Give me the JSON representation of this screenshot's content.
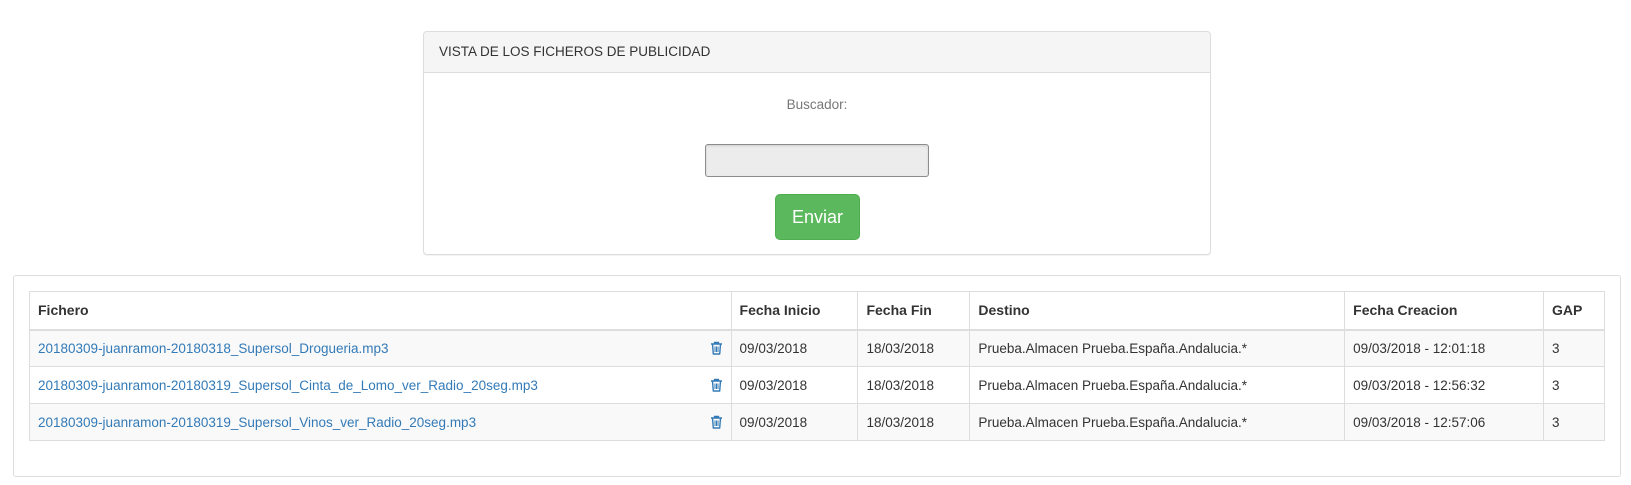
{
  "search": {
    "panel_title": "VISTA DE LOS FICHEROS DE PUBLICIDAD",
    "label": "Buscador:",
    "input_value": "",
    "submit_label": "Enviar"
  },
  "table": {
    "headers": {
      "file": "Fichero",
      "start_date": "Fecha Inicio",
      "end_date": "Fecha Fin",
      "destination": "Destino",
      "created": "Fecha Creacion",
      "gap": "GAP"
    },
    "rows": [
      {
        "file": "20180309-juanramon-20180318_Supersol_Drogueria.mp3",
        "start_date": "09/03/2018",
        "end_date": "18/03/2018",
        "destination": "Prueba.Almacen Prueba.España.Andalucia.*",
        "created": "09/03/2018 - 12:01:18",
        "gap": "3"
      },
      {
        "file": "20180309-juanramon-20180319_Supersol_Cinta_de_Lomo_ver_Radio_20seg.mp3",
        "start_date": "09/03/2018",
        "end_date": "18/03/2018",
        "destination": "Prueba.Almacen Prueba.España.Andalucia.*",
        "created": "09/03/2018 - 12:56:32",
        "gap": "3"
      },
      {
        "file": "20180309-juanramon-20180319_Supersol_Vinos_ver_Radio_20seg.mp3",
        "start_date": "09/03/2018",
        "end_date": "18/03/2018",
        "destination": "Prueba.Almacen Prueba.España.Andalucia.*",
        "created": "09/03/2018 - 12:57:06",
        "gap": "3"
      }
    ]
  },
  "icons": {
    "delete": "trash-icon"
  },
  "colors": {
    "link": "#337ab7",
    "submit": "#5cb85c",
    "delete_icon": "#337ab7"
  }
}
